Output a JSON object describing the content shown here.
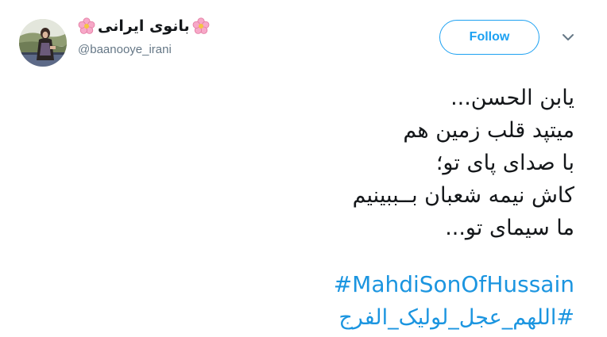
{
  "user": {
    "display_name": "بانوی ایرانی",
    "handle": "@baanooye_irani",
    "name_emoji_left": "flower-icon",
    "name_emoji_right": "flower-icon"
  },
  "actions": {
    "follow_label": "Follow",
    "menu_icon": "chevron-down-icon"
  },
  "tweet": {
    "lines": [
      "یابن الحسن...",
      "میتپد قلب زمین هم",
      "با صدای پای تو؛",
      "کاش نیمه شعبان بــببینیم",
      "ما سیمای تو..."
    ],
    "hashtags": [
      "#MahdiSonOfHussain",
      "#اللهم_عجل_لولیک_الفرج"
    ]
  },
  "colors": {
    "link": "#1b95e0",
    "accent": "#1da1f2",
    "text": "#14171a",
    "muted": "#657786"
  }
}
